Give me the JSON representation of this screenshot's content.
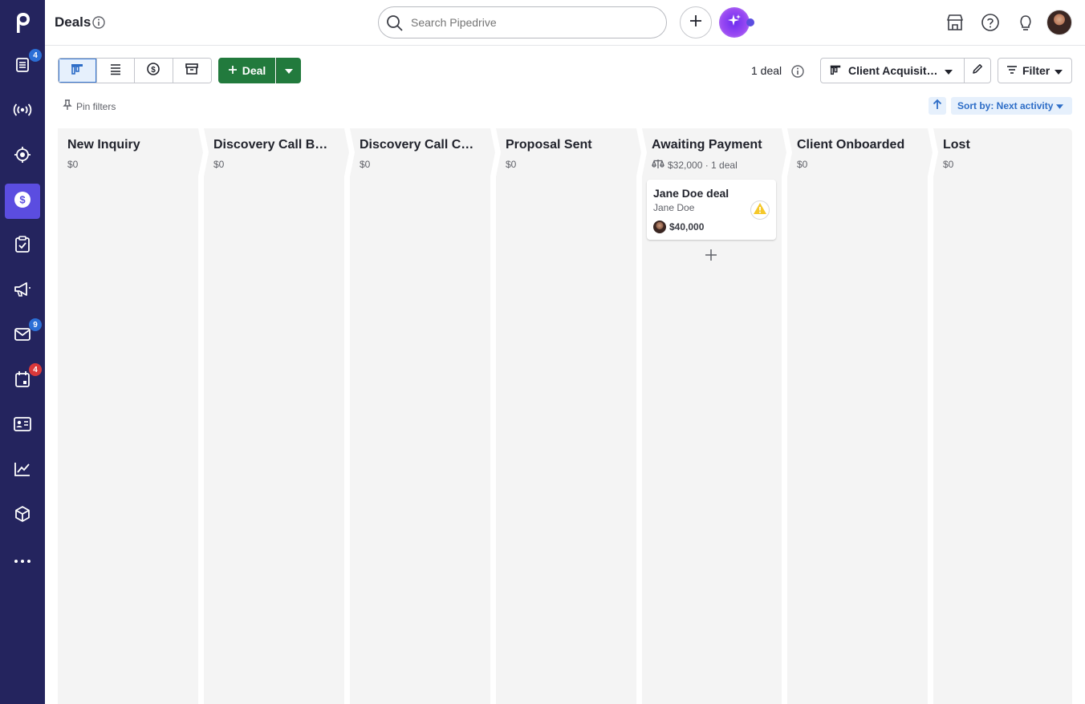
{
  "app": {
    "page_title": "Deals",
    "search_placeholder": "Search Pipedrive"
  },
  "sidebar": {
    "items": [
      {
        "name": "leads-icon",
        "badge": "4",
        "badge_color": "blue"
      },
      {
        "name": "broadcast-icon",
        "badge": ""
      },
      {
        "name": "target-icon",
        "badge": ""
      },
      {
        "name": "deals-icon",
        "badge": "",
        "active": true
      },
      {
        "name": "activities-icon",
        "badge": ""
      },
      {
        "name": "campaigns-icon",
        "badge": ""
      },
      {
        "name": "mail-icon",
        "badge": "9",
        "badge_color": "blue"
      },
      {
        "name": "calendar-icon",
        "badge": "4",
        "badge_color": "red"
      },
      {
        "name": "contacts-icon",
        "badge": ""
      },
      {
        "name": "insights-icon",
        "badge": ""
      },
      {
        "name": "products-icon",
        "badge": ""
      },
      {
        "name": "more-icon",
        "badge": ""
      }
    ]
  },
  "toolbar": {
    "deal_button_label": "Deal",
    "deal_count": "1 deal",
    "pipeline_label": "Client Acquisition",
    "filter_label": "Filter",
    "pin_filters_label": "Pin filters",
    "sort_label": "Sort by: Next activity"
  },
  "stages": [
    {
      "name": "New Inquiry",
      "sum": "$0"
    },
    {
      "name": "Discovery Call Booked",
      "sum": "$0"
    },
    {
      "name": "Discovery Call Completed",
      "sum": "$0"
    },
    {
      "name": "Proposal Sent",
      "sum": "$0"
    },
    {
      "name": "Awaiting Payment",
      "sum": "$32,000 · 1 deal"
    },
    {
      "name": "Client Onboarded",
      "sum": "$0"
    },
    {
      "name": "Lost",
      "sum": "$0"
    }
  ],
  "deal_card": {
    "title": "Jane Doe deal",
    "person": "Jane Doe",
    "value": "$40,000"
  },
  "colors": {
    "sidebar_bg": "#24245e",
    "active_item": "#5b4de0",
    "deal_button": "#227a3d",
    "link_blue": "#2d6dc7"
  }
}
